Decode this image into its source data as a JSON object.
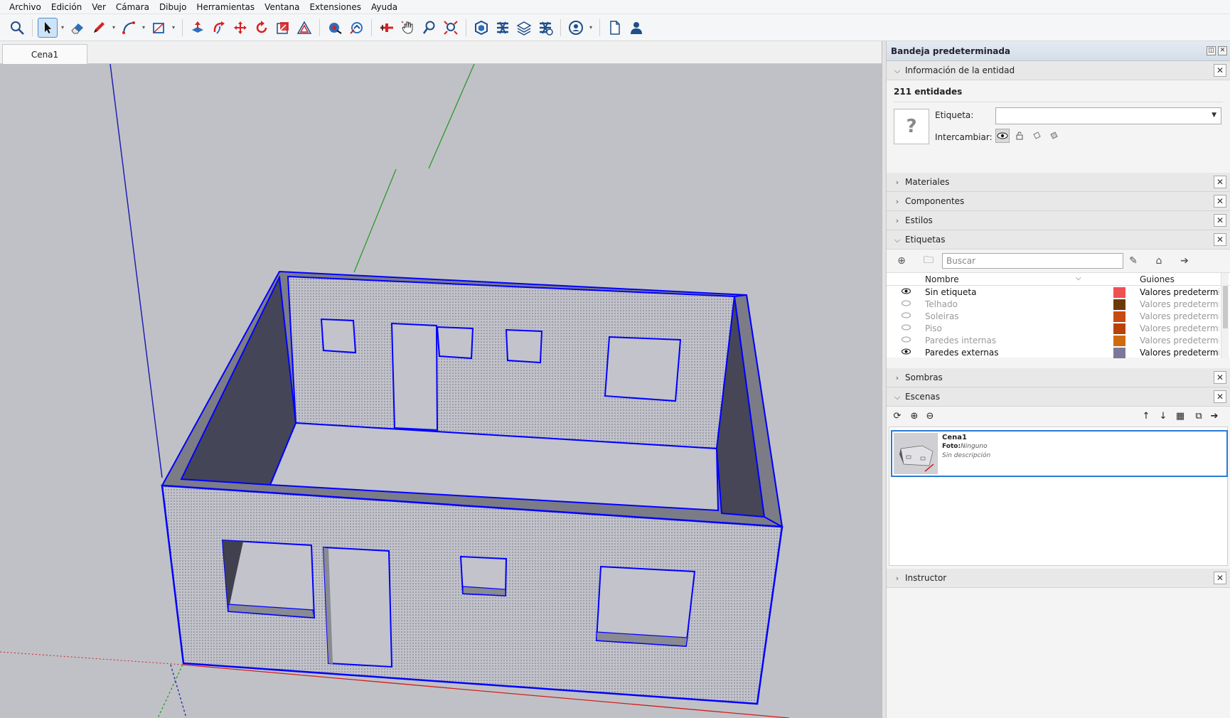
{
  "menu": [
    "Archivo",
    "Edición",
    "Ver",
    "Cámara",
    "Dibujo",
    "Herramientas",
    "Ventana",
    "Extensiones",
    "Ayuda"
  ],
  "toolbar": {
    "groups": [
      [
        "zoom-icon"
      ],
      [
        "select-icon",
        "eraser-icon",
        "pencil-icon",
        "arc-icon",
        "rectangle-icon"
      ],
      [
        "push-pull-icon",
        "follow-me-icon",
        "move-icon",
        "rotate-icon",
        "scale-icon",
        "offset-icon"
      ],
      [
        "tape-measure-icon",
        "protractor-icon"
      ],
      [
        "section-plane-icon",
        "pan-icon",
        "zoom-tool-icon",
        "zoom-extents-icon"
      ],
      [
        "3d-warehouse-icon",
        "extension-warehouse-icon",
        "layout-icon",
        "extension-manager-icon",
        "account-icon"
      ],
      [
        "new-file-icon",
        "profile-icon"
      ]
    ]
  },
  "scene_tab": "Cena1",
  "tray": {
    "title": "Bandeja predeterminada",
    "entity_info": {
      "title": "Información de la entidad",
      "count": "211 entidades",
      "tag_label": "Etiqueta:",
      "toggle_label": "Intercambiar:"
    },
    "panels": {
      "materials": "Materiales",
      "components": "Componentes",
      "styles": "Estilos",
      "tags": "Etiquetas",
      "shadows": "Sombras",
      "scenes": "Escenas",
      "instructor": "Instructor"
    },
    "tags": {
      "search_placeholder": "Buscar",
      "col_name": "Nombre",
      "col_dashes": "Guiones",
      "rows": [
        {
          "name": "Sin etiqueta",
          "visible": true,
          "color": "#f05050",
          "dashes": "Valores predeterminados"
        },
        {
          "name": "Telhado",
          "visible": false,
          "color": "#6b3a08",
          "dashes": "Valores predeterminados"
        },
        {
          "name": "Soleiras",
          "visible": false,
          "color": "#c84a10",
          "dashes": "Valores predeterminados"
        },
        {
          "name": "Piso",
          "visible": false,
          "color": "#b84208",
          "dashes": "Valores predeterminados"
        },
        {
          "name": "Paredes internas",
          "visible": false,
          "color": "#d06a10",
          "dashes": "Valores predeterminados"
        },
        {
          "name": "Paredes externas",
          "visible": true,
          "color": "#7a7a98",
          "dashes": "Valores predeterminados"
        }
      ]
    },
    "scenes": {
      "name": "Cena1",
      "photo_label": "Foto:",
      "photo_value": "Ninguno",
      "description": "Sin descripción"
    }
  },
  "colors": {
    "selection_blue": "#0000ff",
    "axis_green": "#2a9a2a",
    "axis_red": "#d02020",
    "viewport_bg": "#c0c1c6"
  }
}
